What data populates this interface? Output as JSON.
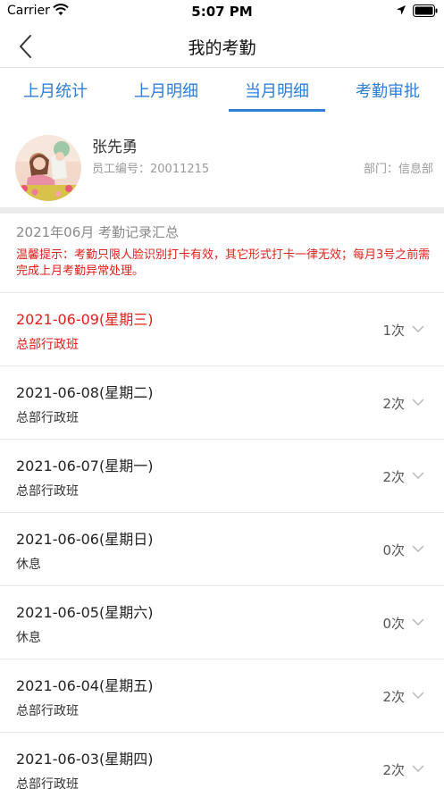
{
  "status_bar": {
    "carrier": "Carrier",
    "time": "5:07 PM",
    "icons": [
      "wifi-icon",
      "location-arrow-icon",
      "battery-icon"
    ]
  },
  "nav": {
    "title": "我的考勤",
    "back_icon": "chevron-left-icon"
  },
  "tabs": [
    {
      "label": "上月统计",
      "active": false
    },
    {
      "label": "上月明细",
      "active": false
    },
    {
      "label": "当月明细",
      "active": true
    },
    {
      "label": "考勤审批",
      "active": false
    }
  ],
  "profile": {
    "name": "张先勇",
    "employee_no_label": "员工编号：",
    "employee_no": "20011215",
    "dept_label": "部门：",
    "dept": "信息部"
  },
  "summary": {
    "title": "2021年06月 考勤记录汇总",
    "notice": "温馨提示：考勤只限人脸识别打卡有效，其它形式打卡一律无效；每月3号之前需完成上月考勤异常处理。"
  },
  "records": [
    {
      "date": "2021-06-09(星期三)",
      "shift": "总部行政班",
      "count": "1次",
      "highlight": true
    },
    {
      "date": "2021-06-08(星期二)",
      "shift": "总部行政班",
      "count": "2次",
      "highlight": false
    },
    {
      "date": "2021-06-07(星期一)",
      "shift": "总部行政班",
      "count": "2次",
      "highlight": false
    },
    {
      "date": "2021-06-06(星期日)",
      "shift": "休息",
      "count": "0次",
      "highlight": false
    },
    {
      "date": "2021-06-05(星期六)",
      "shift": "休息",
      "count": "0次",
      "highlight": false
    },
    {
      "date": "2021-06-04(星期五)",
      "shift": "总部行政班",
      "count": "2次",
      "highlight": false
    },
    {
      "date": "2021-06-03(星期四)",
      "shift": "总部行政班",
      "count": "2次",
      "highlight": false
    }
  ],
  "colors": {
    "accent": "#2f7ed8",
    "alert": "#e0201b",
    "muted": "#9a9a9a"
  }
}
